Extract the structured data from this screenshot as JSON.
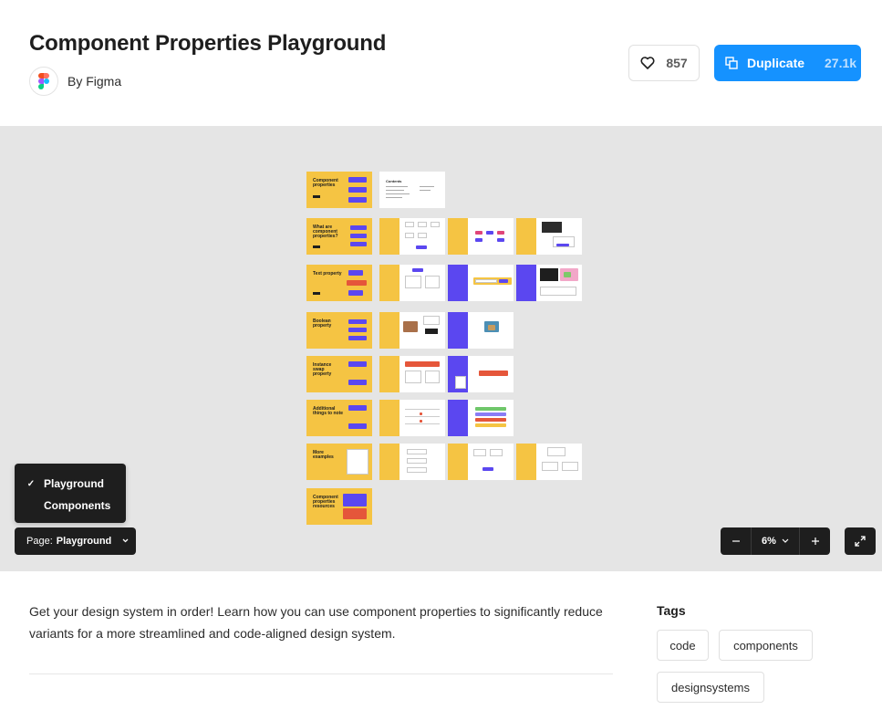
{
  "header": {
    "title": "Component Properties Playground",
    "author": "By Figma",
    "likes": "857",
    "duplicate_label": "Duplicate",
    "duplicate_count": "27.1k"
  },
  "canvas": {
    "frames": [
      {
        "title": "Component properties"
      },
      {
        "title": "Contents"
      },
      {
        "title": "What are component properties?"
      },
      {
        "title": "Text property"
      },
      {
        "title": "Boolean property"
      },
      {
        "title": "Instance swap property"
      },
      {
        "title": "Additional things to note"
      },
      {
        "title": "More examples"
      },
      {
        "title": "Component properties resources"
      }
    ],
    "pages": [
      {
        "label": "Playground",
        "selected": true
      },
      {
        "label": "Components",
        "selected": false
      }
    ],
    "page_select_prefix": "Page:",
    "page_select_value": "Playground",
    "zoom_value": "6%"
  },
  "description": "Get your design system in order! Learn how you can use component properties to significantly reduce variants for a more streamlined and code-aligned design system.",
  "tags": {
    "title": "Tags",
    "items": [
      "code",
      "components",
      "designsystems"
    ]
  },
  "colors": {
    "accent": "#1592ff",
    "yellow": "#f5c443",
    "purple": "#5b47f0",
    "canvas_bg": "#e5e5e5"
  }
}
